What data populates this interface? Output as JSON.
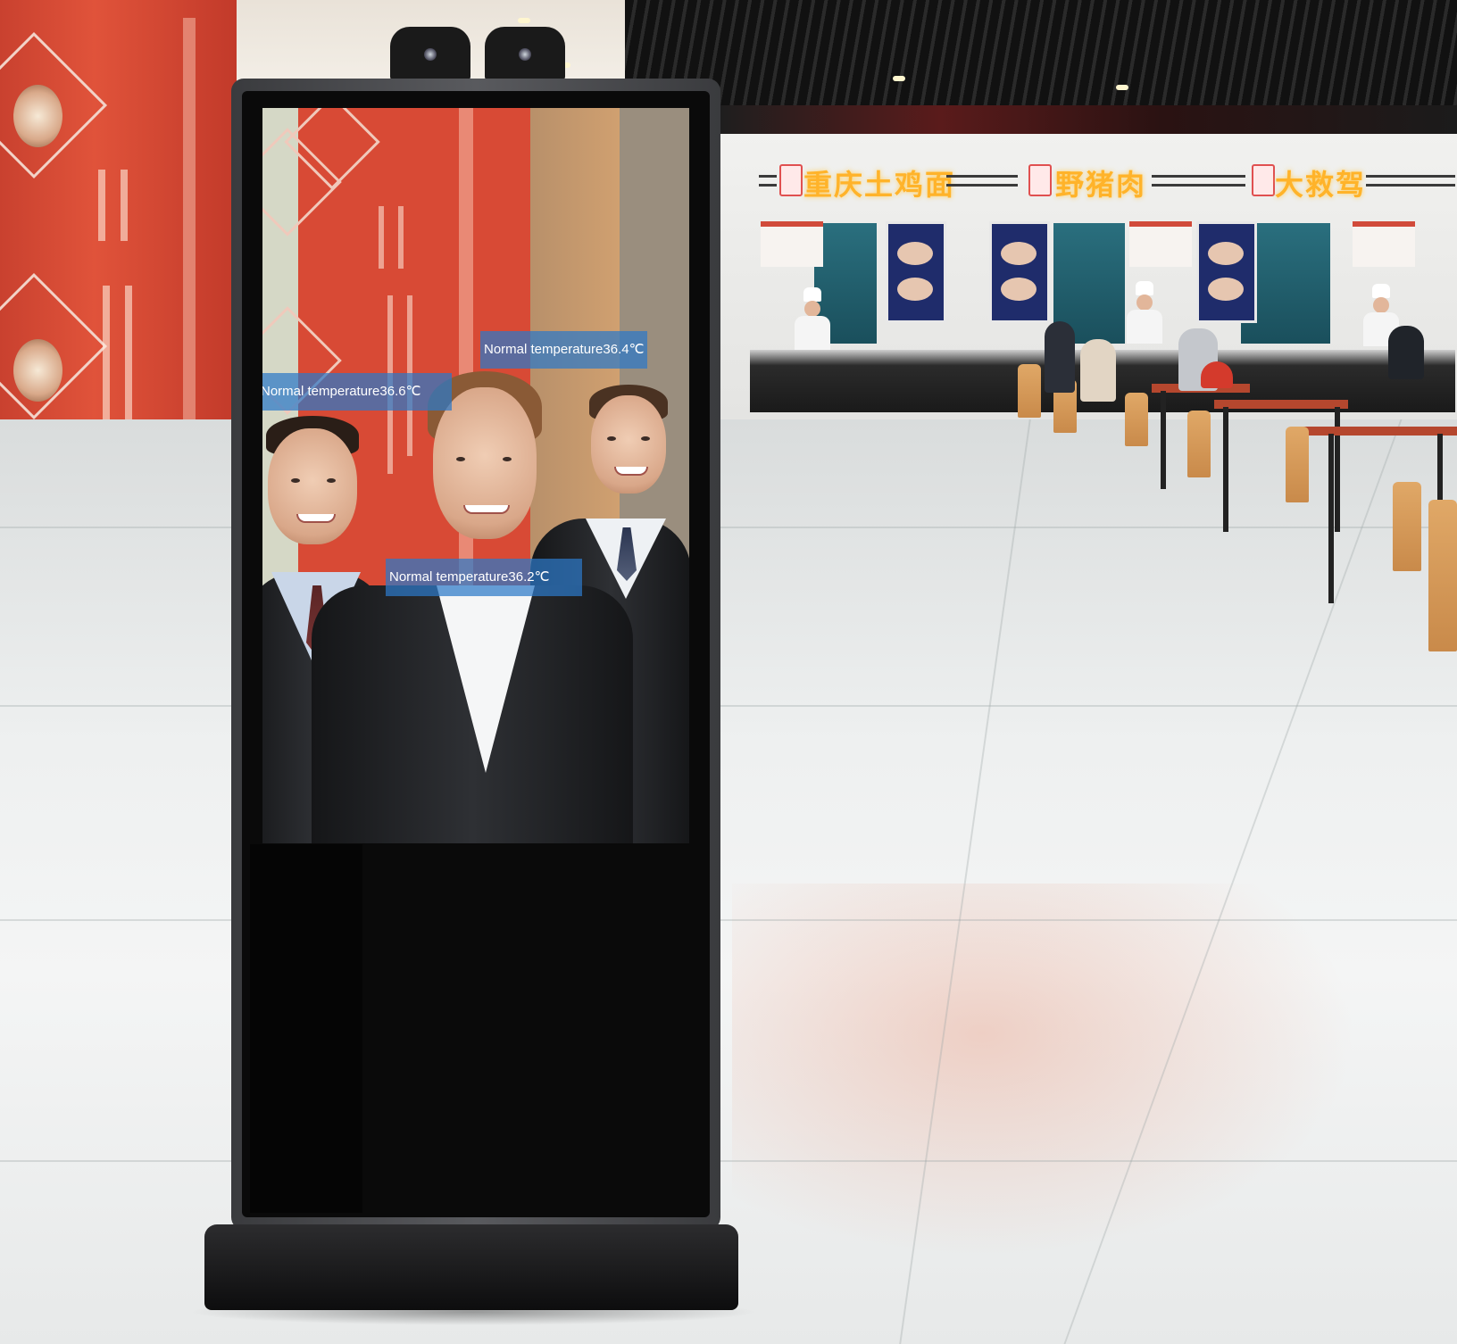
{
  "colors": {
    "accent_strip": "#3fb8e6",
    "temperature_label_bg": "#2d78c8",
    "kiosk_frame": "#4a4b4f"
  },
  "kiosk": {
    "screen": {
      "temperature_labels": [
        "Normal temperature36.4℃",
        "Normal temperature36.6℃",
        "Normal temperature36.2℃"
      ]
    }
  },
  "background": {
    "stall_signs": [
      "重庆土鸡面",
      "野猪肉",
      "大救驾"
    ]
  }
}
